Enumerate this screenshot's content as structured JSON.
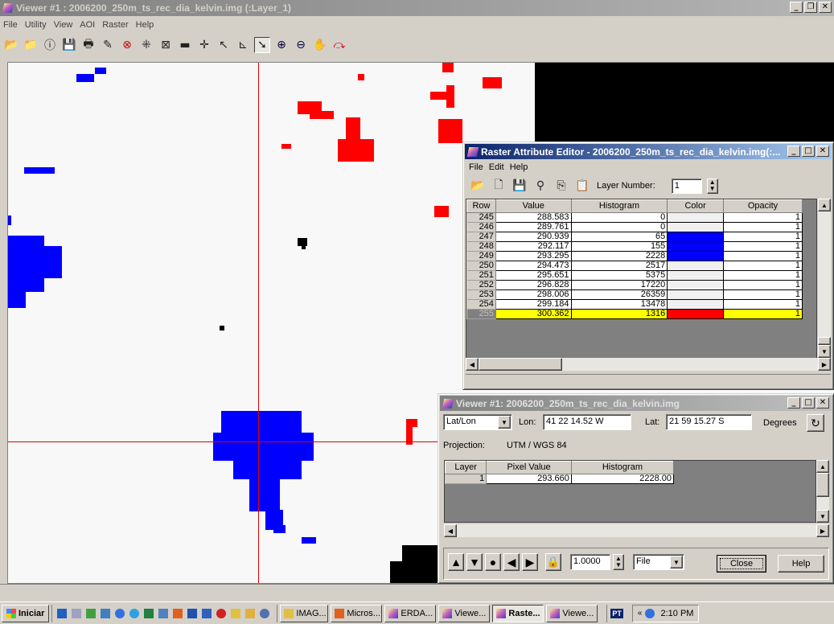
{
  "main_window": {
    "title": "Viewer #1 : 2006200_250m_ts_rec_dia_kelvin.img (:Layer_1)",
    "menu": [
      "File",
      "Utility",
      "View",
      "AOI",
      "Raster",
      "Help"
    ]
  },
  "raster_editor": {
    "title": "Raster Attribute Editor - 2006200_250m_ts_rec_dia_kelvin.img(:...",
    "menu": [
      "File",
      "Edit",
      "Help"
    ],
    "layer_number_label": "Layer Number:",
    "layer_number_value": "1",
    "columns": [
      "Row",
      "Value",
      "Histogram",
      "Color",
      "Opacity"
    ],
    "rows": [
      {
        "row": "245",
        "value": "288.583",
        "histogram": "0",
        "color": "#f0f0f0",
        "opacity": "1"
      },
      {
        "row": "246",
        "value": "289.761",
        "histogram": "0",
        "color": "#f0f0f0",
        "opacity": "1"
      },
      {
        "row": "247",
        "value": "290.939",
        "histogram": "65",
        "color": "#0000ff",
        "opacity": "1"
      },
      {
        "row": "248",
        "value": "292.117",
        "histogram": "155",
        "color": "#0000ff",
        "opacity": "1"
      },
      {
        "row": "249",
        "value": "293.295",
        "histogram": "2228",
        "color": "#0000ff",
        "opacity": "1"
      },
      {
        "row": "250",
        "value": "294.473",
        "histogram": "2517",
        "color": "#f0f0f0",
        "opacity": "1"
      },
      {
        "row": "251",
        "value": "295.651",
        "histogram": "5375",
        "color": "#f0f0f0",
        "opacity": "1"
      },
      {
        "row": "252",
        "value": "296.828",
        "histogram": "17220",
        "color": "#f0f0f0",
        "opacity": "1"
      },
      {
        "row": "253",
        "value": "298.006",
        "histogram": "26359",
        "color": "#f0f0f0",
        "opacity": "1"
      },
      {
        "row": "254",
        "value": "299.184",
        "histogram": "13478",
        "color": "#f0f0f0",
        "opacity": "1"
      },
      {
        "row": "255",
        "value": "300.362",
        "histogram": "1316",
        "color": "#ff0000",
        "opacity": "1",
        "highlight": "#ffff00"
      }
    ]
  },
  "inquire_window": {
    "title": "Viewer #1:  2006200_250m_ts_rec_dia_kelvin.img",
    "coord_type": "Lat/Lon",
    "lon_label": "Lon:",
    "lon_value": "41 22 14.52 W",
    "lat_label": "Lat:",
    "lat_value": "21 59 15.27 S",
    "units": "Degrees",
    "projection_label": "Projection:",
    "projection_value": "UTM / WGS 84",
    "columns": [
      "Layer",
      "Pixel Value",
      "Histogram"
    ],
    "rows": [
      {
        "layer": "1",
        "pixel_value": "293.660",
        "histogram": "2228.00"
      }
    ],
    "step_value": "1.0000",
    "mode_value": "File",
    "close_label": "Close",
    "help_label": "Help"
  },
  "taskbar": {
    "start_label": "Iniciar",
    "tasks": [
      "IMAG...",
      "Micros...",
      "ERDA...",
      "Viewe...",
      "Raste...",
      "Viewe..."
    ],
    "active_task": "Raste...",
    "lang": "PT",
    "clock": "2:10 PM"
  },
  "colors": {
    "blue_class": "#0000ff",
    "red_class": "#ff0000",
    "crosshair": "#e00000",
    "selected_row": "#ffff00"
  }
}
